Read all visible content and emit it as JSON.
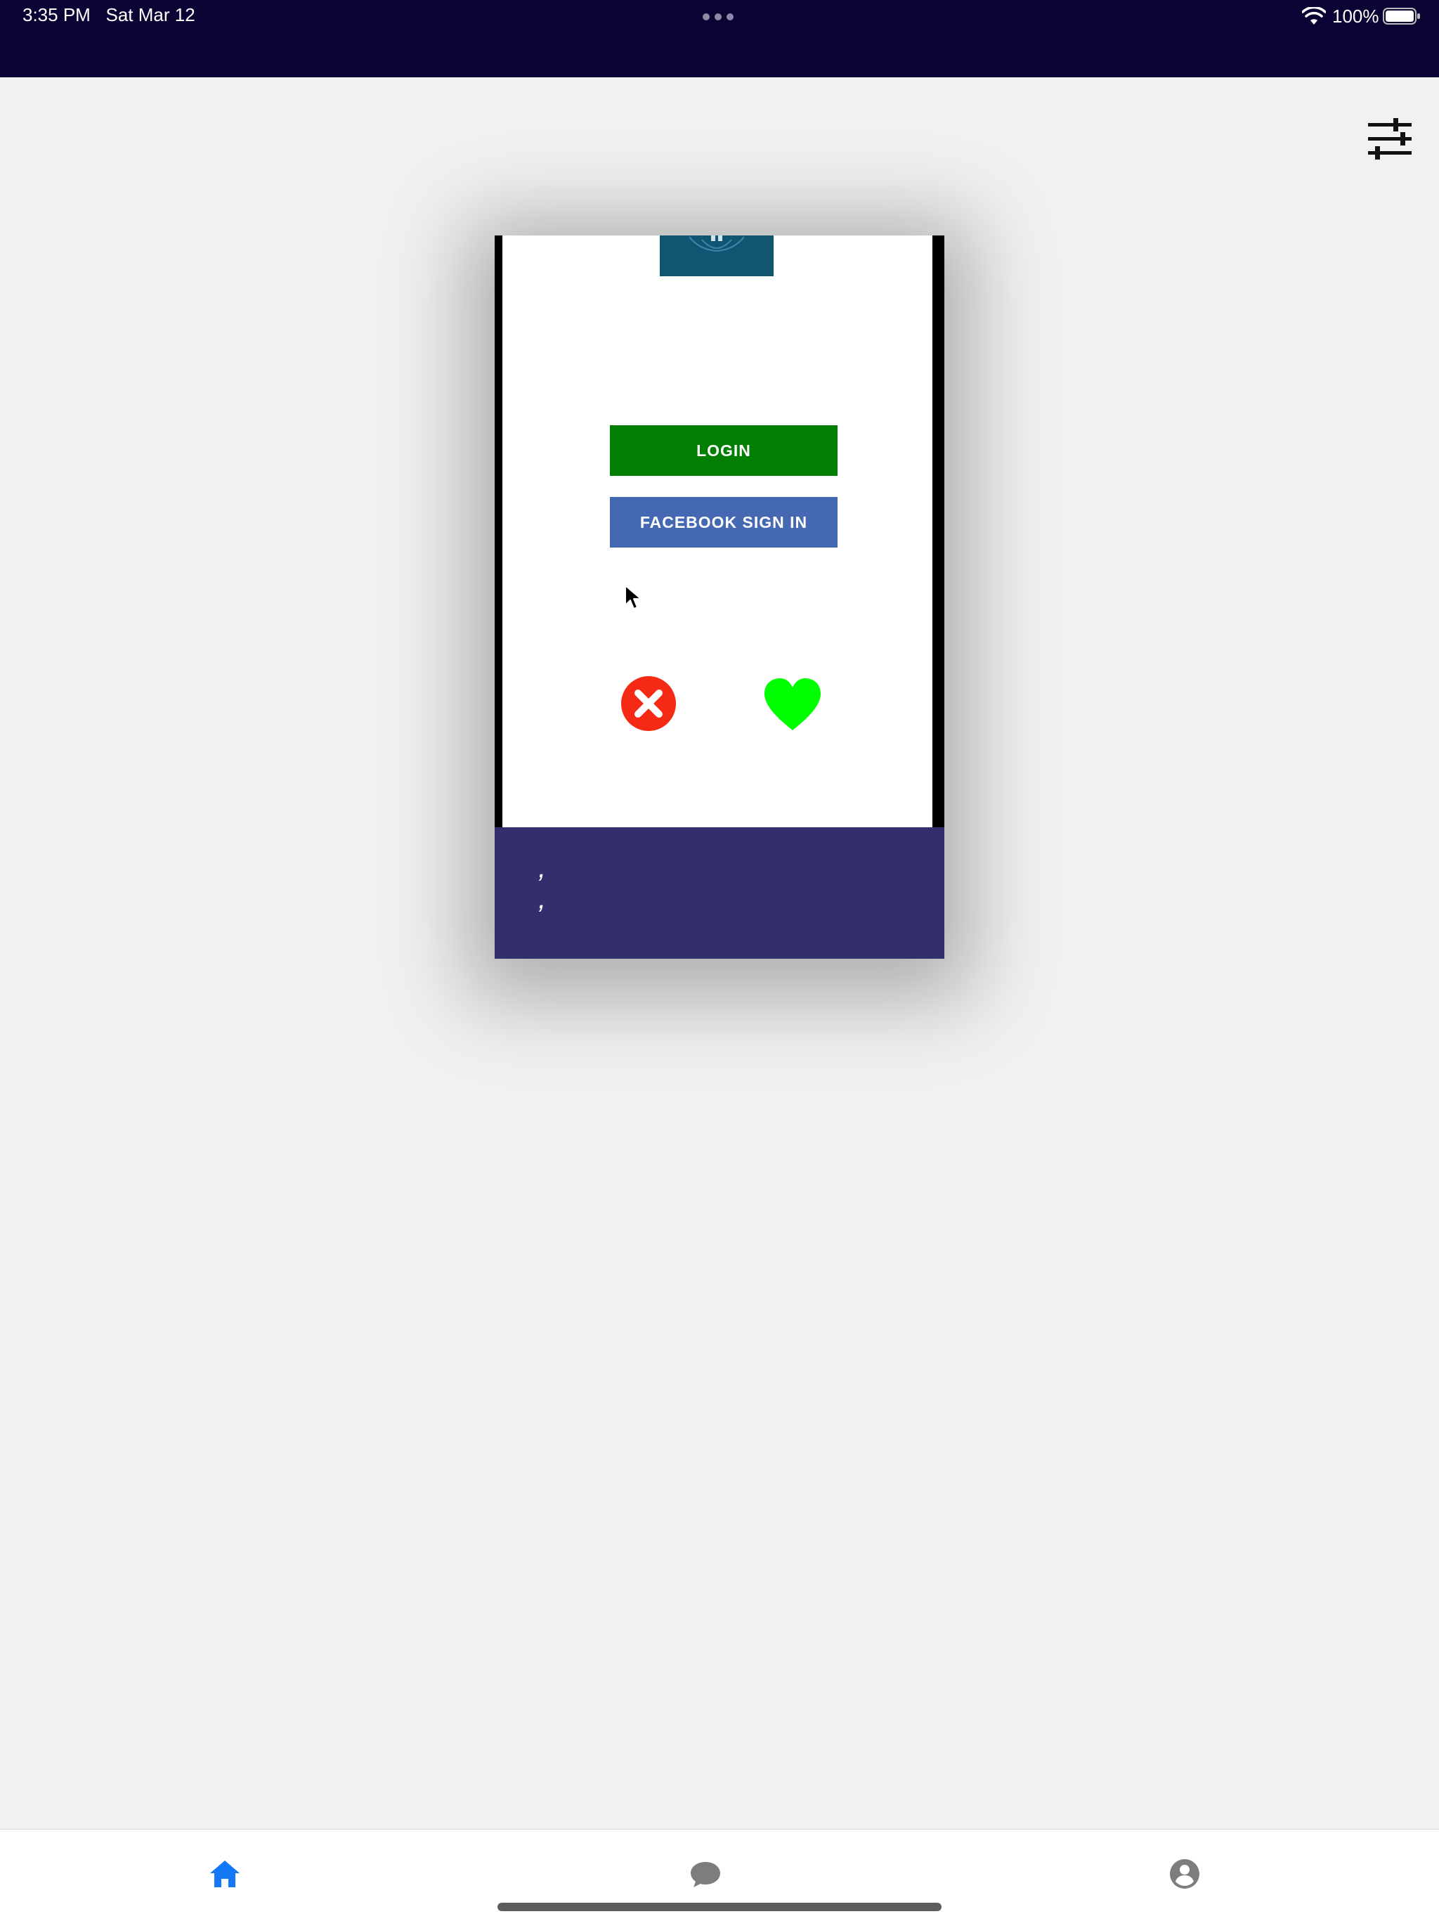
{
  "status_bar": {
    "time": "3:35 PM   Sat Mar 12",
    "battery": "100%",
    "icons": [
      "more-dots-icon",
      "wifi-icon",
      "battery-icon"
    ]
  },
  "header": {
    "icons": [
      "filter-sliders-icon"
    ]
  },
  "card": {
    "login_label": "LOGIN",
    "facebook_label": "FACEBOOK SIGN IN",
    "info_line_1": ",",
    "info_line_2": ",",
    "icons": [
      "app-logo-icon",
      "mouse-pointer-icon",
      "reject-x-icon",
      "like-heart-icon"
    ],
    "colors": {
      "login": "#017f03",
      "facebook": "#4568b2",
      "reject": "#f52a15",
      "like": "#00ff00",
      "info_panel": "#332f6f",
      "logo": "#105673"
    }
  },
  "tab_bar": {
    "tabs": [
      {
        "icon": "home-icon",
        "active": true
      },
      {
        "icon": "chat-bubble-icon",
        "active": false
      },
      {
        "icon": "profile-icon",
        "active": false
      }
    ],
    "active_color": "#1477f6",
    "inactive_color": "#7d7d7d"
  },
  "status_bar_color": "#0c0233"
}
